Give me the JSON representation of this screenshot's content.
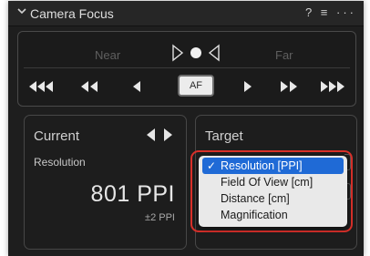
{
  "panel": {
    "title": "Camera Focus",
    "tools": "? ≡ ···"
  },
  "focus": {
    "near_label": "Near",
    "far_label": "Far",
    "af_label": "AF"
  },
  "current": {
    "title": "Current",
    "subtitle": "Resolution",
    "value": "801 PPI",
    "tolerance": "±2 PPI"
  },
  "target": {
    "title": "Target",
    "menu": {
      "check_mark": "✓",
      "items": [
        {
          "label": "Resolution [PPI]"
        },
        {
          "label": "Field Of View [cm]"
        },
        {
          "label": "Distance [cm]"
        },
        {
          "label": "Magnification"
        }
      ],
      "selected_index": 0
    }
  },
  "colors": {
    "accent": "#1f6ad6",
    "highlight_outline": "#d8302a"
  }
}
